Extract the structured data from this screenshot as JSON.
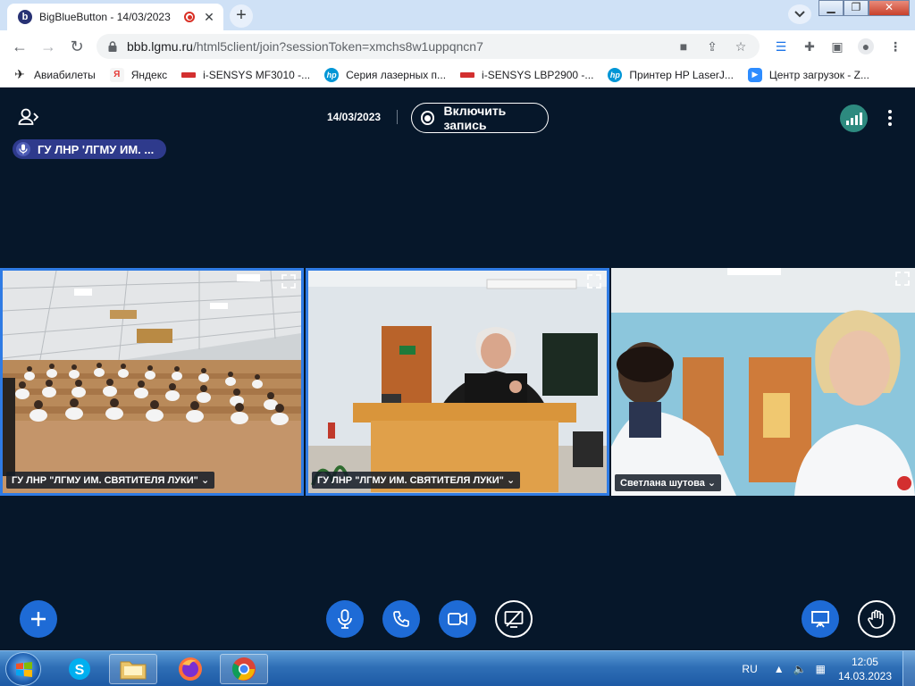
{
  "browser": {
    "tab_title": "BigBlueButton - 14/03/2023",
    "tab_favicon_letter": "b",
    "url_host": "bbb.lgmu.ru",
    "url_path": "/html5client/join?sessionToken=xmchs8w1uppqncn7"
  },
  "bookmarks": [
    {
      "label": "Авиабилеты",
      "icon": "plane-icon"
    },
    {
      "label": "Яндекс",
      "icon": "yandex-icon"
    },
    {
      "label": "i-SENSYS MF3010 -...",
      "icon": "canon-icon"
    },
    {
      "label": "Серия лазерных п...",
      "icon": "hp-icon"
    },
    {
      "label": "i-SENSYS LBP2900 -...",
      "icon": "canon-icon"
    },
    {
      "label": "Принтер HP LaserJ...",
      "icon": "hp-icon"
    },
    {
      "label": "Центр загрузок - Z...",
      "icon": "zoom-icon"
    }
  ],
  "app": {
    "meeting_date": "14/03/2023",
    "record_label": "Включить запись",
    "talking_indicator": "ГУ ЛНР 'ЛГМУ ИМ. ...",
    "videos": [
      {
        "name": "ГУ ЛНР \"ЛГМУ ИМ. СВЯТИТЕЛЯ ЛУКИ\"",
        "active": true
      },
      {
        "name": "ГУ ЛНР \"ЛГМУ ИМ. СВЯТИТЕЛЯ ЛУКИ\"",
        "active": true
      },
      {
        "name": "Светлана шутова",
        "active": false
      }
    ],
    "name_caret": "⌄",
    "colors": {
      "background": "#06172a",
      "primary": "#1e6bd6",
      "talking": "#2e3a8c",
      "connection": "#2d8a7f"
    }
  },
  "taskbar": {
    "language": "RU",
    "time": "12:05",
    "date": "14.03.2023",
    "apps": [
      "skype-icon",
      "explorer-icon",
      "firefox-icon",
      "chrome-icon"
    ]
  }
}
